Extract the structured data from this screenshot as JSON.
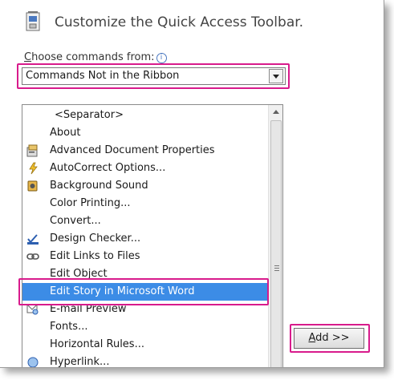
{
  "header": {
    "title": "Customize the Quick Access Toolbar.",
    "icon": "toolbar-customize-icon"
  },
  "choose": {
    "label_prefix": "C",
    "label_rest": "hoose commands from:",
    "info_glyph": "i",
    "selected": "Commands Not in the Ribbon"
  },
  "commands": {
    "items": [
      {
        "label": "<Separator>",
        "icon": ""
      },
      {
        "label": "About",
        "icon": ""
      },
      {
        "label": "Advanced Document Properties",
        "icon": "document-properties-icon"
      },
      {
        "label": "AutoCorrect Options...",
        "icon": "autocorrect-lightning-icon"
      },
      {
        "label": "Background Sound",
        "icon": "sound-speaker-icon"
      },
      {
        "label": "Color Printing...",
        "icon": ""
      },
      {
        "label": "Convert...",
        "icon": ""
      },
      {
        "label": "Design Checker...",
        "icon": "design-checker-icon"
      },
      {
        "label": "Edit Links to Files",
        "icon": "chain-link-icon"
      },
      {
        "label": "Edit Object",
        "icon": ""
      },
      {
        "label": "Edit Story in Microsoft Word",
        "icon": ""
      },
      {
        "label": "E-mail Preview",
        "icon": "email-preview-icon"
      },
      {
        "label": "Fonts...",
        "icon": ""
      },
      {
        "label": "Horizontal Rules...",
        "icon": ""
      },
      {
        "label": "Hyperlink...",
        "icon": "hyperlink-icon"
      }
    ],
    "selected_index": 10
  },
  "add_button": {
    "label_prefix": "A",
    "label_rest": "dd >>"
  },
  "colors": {
    "highlight": "#d81b8c",
    "selection": "#3c8ce6"
  }
}
